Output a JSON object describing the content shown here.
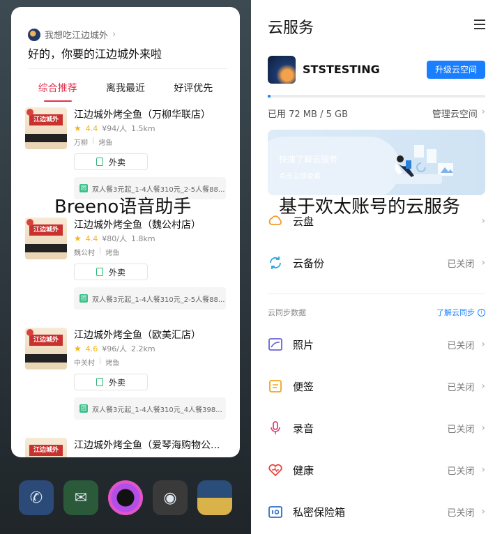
{
  "left": {
    "query": "我想吃江边城外",
    "answer": "好的，你要的江边城外来啦",
    "tabs": [
      "综合推荐",
      "离我最近",
      "好评优先"
    ],
    "restaurants": [
      {
        "name": "江边城外烤全鱼（万柳华联店）",
        "rating": "4.4",
        "price": "¥94/人",
        "distance": "1.5km",
        "area": "万柳",
        "category": "烤鱼",
        "delivery": "外卖",
        "deal": "双人餐3元起_1-4人餐310元_2-5人餐88..."
      },
      {
        "name": "江边城外烤全鱼（魏公村店）",
        "rating": "4.4",
        "price": "¥80/人",
        "distance": "1.8km",
        "area": "魏公村",
        "category": "烤鱼",
        "delivery": "外卖",
        "deal": "双人餐3元起_1-4人餐310元_2-5人餐88..."
      },
      {
        "name": "江边城外烤全鱼（欧美汇店）",
        "rating": "4.6",
        "price": "¥96/人",
        "distance": "2.2km",
        "area": "中关村",
        "category": "烤鱼",
        "delivery": "外卖",
        "deal": "双人餐3元起_1-4人餐310元_4人餐398..."
      },
      {
        "name": "江边城外烤全鱼（爱琴海购物公..."
      }
    ],
    "thumb_text": "江边城外",
    "overlay": "Breeno语音助手",
    "dock_icons": [
      "phone-icon",
      "message-icon",
      "breeno-icon",
      "camera-icon",
      "gallery-icon"
    ]
  },
  "right": {
    "title": "云服务",
    "account_name": "STSTESTING",
    "upgrade": "升级云空间",
    "storage_used": "已用 72 MB / 5 GB",
    "storage_fraction": 0.014,
    "manage": "管理云空间",
    "banner_title": "快速了解云服务",
    "banner_sub": "点击立即查看",
    "overlay": "基于欢太账号的云服务",
    "top_items": [
      {
        "label": "云盘",
        "status": "",
        "icon": "cloud-drive-icon"
      },
      {
        "label": "云备份",
        "status": "已关闭",
        "icon": "cloud-backup-icon"
      }
    ],
    "sync_title": "云同步数据",
    "sync_link": "了解云同步",
    "sync_items": [
      {
        "label": "照片",
        "status": "已关闭",
        "icon": "photos-icon"
      },
      {
        "label": "便签",
        "status": "已关闭",
        "icon": "notes-icon"
      },
      {
        "label": "录音",
        "status": "已关闭",
        "icon": "recorder-icon"
      },
      {
        "label": "健康",
        "status": "已关闭",
        "icon": "health-icon"
      },
      {
        "label": "私密保险箱",
        "status": "已关闭",
        "icon": "safe-box-icon"
      }
    ],
    "colors": {
      "accent": "#1a7fff",
      "breeno_active": "#e0334d"
    }
  }
}
